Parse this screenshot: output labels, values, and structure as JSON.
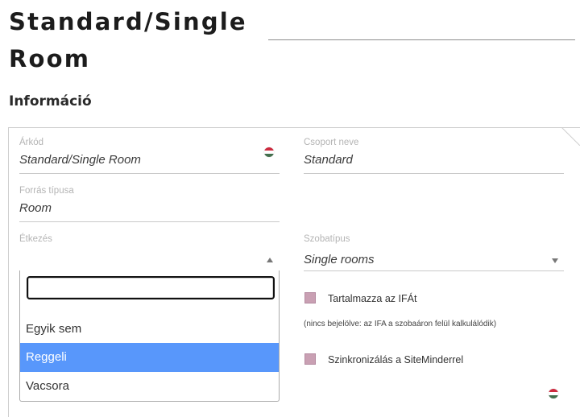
{
  "page": {
    "title": "Standard/Single Room",
    "section_heading": "Információ"
  },
  "fields": {
    "rate_code": {
      "label": "Árkód",
      "value": "Standard/Single Room"
    },
    "group_name": {
      "label": "Csoport neve",
      "value": "Standard"
    },
    "source_type": {
      "label": "Forrás típusa",
      "value": "Room"
    },
    "meals": {
      "label": "Étkezés",
      "value": ""
    },
    "room_type": {
      "label": "Szobatípus",
      "value": "Single rooms"
    }
  },
  "meals_dropdown": {
    "search_value": "",
    "options": [
      {
        "label": "Egyik sem",
        "highlighted": false
      },
      {
        "label": "Reggeli",
        "highlighted": true
      },
      {
        "label": "Vacsora",
        "highlighted": false
      }
    ]
  },
  "checkboxes": {
    "includes_vat": {
      "label": "Tartalmazza az IFÁt",
      "checked": false
    },
    "vat_hint": "(nincs bejelölve: az IFA a szobaáron felül kalkulálódik)",
    "siteminder_sync": {
      "label": "Szinkronizálás a SiteMinderrel",
      "checked": false
    }
  },
  "icons": {
    "language_flag": "hungarian-flag-icon",
    "flag_colors": [
      "#cd2a3e",
      "#ffffff",
      "#436f4d"
    ],
    "dropdown_open_arrow": "triangle-up-icon",
    "dropdown_closed_arrow": "triangle-down-icon"
  },
  "colors": {
    "highlight": "#5897fb",
    "checkbox": "#c9a0b3"
  }
}
